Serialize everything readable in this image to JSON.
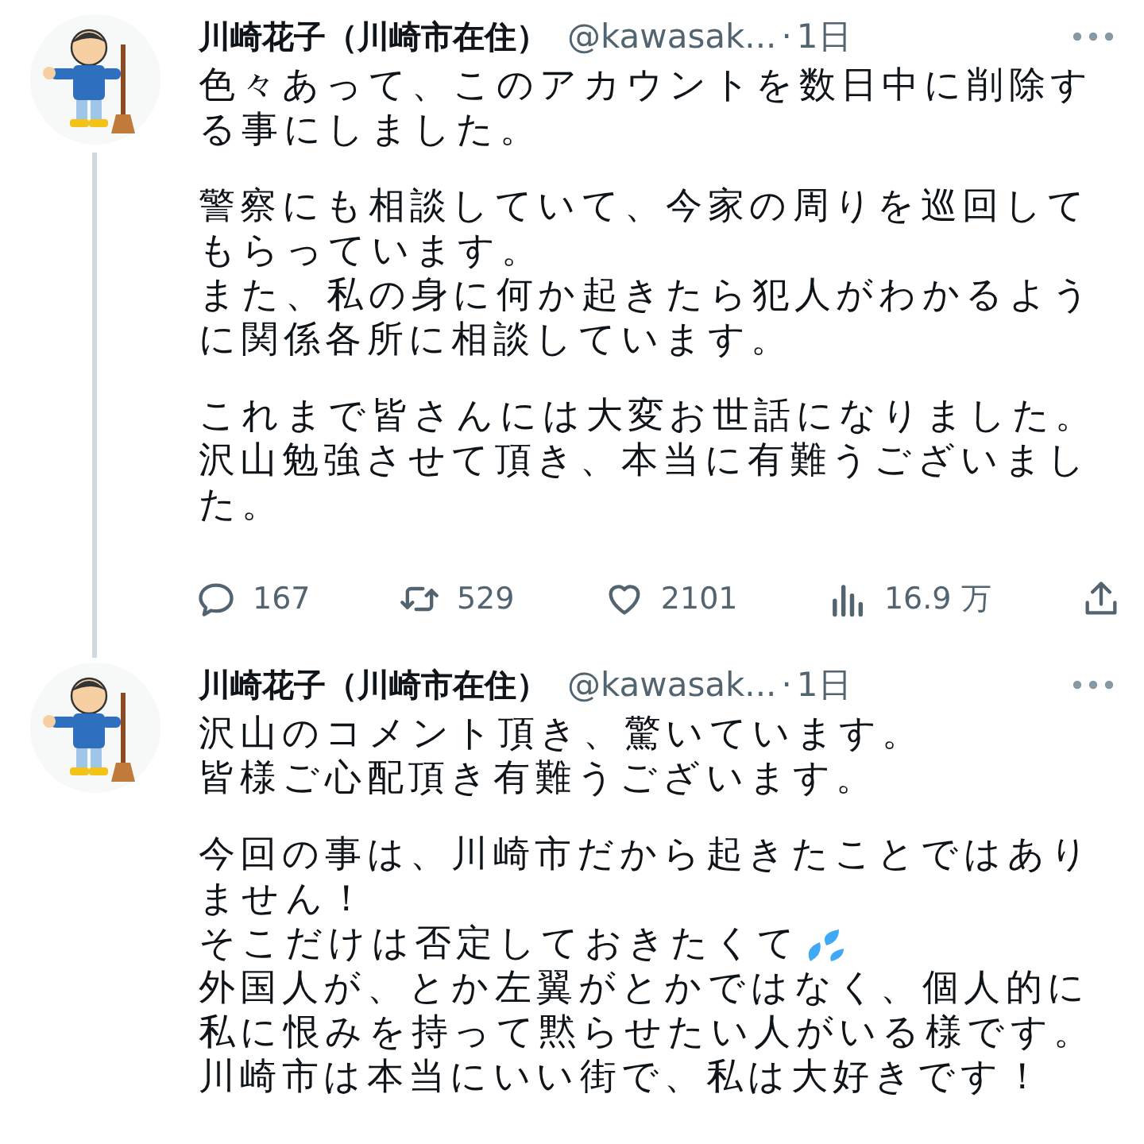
{
  "tweets": [
    {
      "name": "川崎花子（川崎市在住）",
      "handle": "@kawasak...",
      "separator": "·",
      "time": "1日",
      "thread_line": true,
      "paragraphs": [
        {
          "lines": [
            {
              "kind": "plain",
              "text": "色々あって、このアカウントを数日中に削除する事にしました。"
            }
          ]
        },
        {
          "lines": [
            {
              "kind": "plain",
              "text": "警察にも相談していて、今家の周りを巡回してもらっています。"
            },
            {
              "kind": "plain",
              "text": "また、私の身に何か起きたら犯人がわかるように関係各所に相談しています。"
            }
          ]
        },
        {
          "lines": [
            {
              "kind": "plain",
              "text": "これまで皆さんには大変お世話になりました。沢山勉強させて頂き、本当に有難うございました。"
            }
          ]
        }
      ],
      "actions": {
        "replies": "167",
        "retweets": "529",
        "likes": "2101",
        "views": "16.9 万"
      }
    },
    {
      "name": "川崎花子（川崎市在住）",
      "handle": "@kawasak...",
      "separator": "·",
      "time": "1日",
      "paragraphs": [
        {
          "lines": [
            {
              "kind": "plain",
              "text": "沢山のコメント頂き、驚いています。"
            },
            {
              "kind": "plain",
              "text": "皆様ご心配頂き有難うございます。"
            }
          ]
        },
        {
          "lines": [
            {
              "kind": "plain",
              "text": "今回の事は、川崎市だから起きたことではありません！"
            },
            {
              "kind": "with-icon",
              "text": "そこだけは否定しておきたくて"
            },
            {
              "kind": "plain",
              "text": "外国人が、とか左翼がとかではなく、個人的に私に恨みを持って黙らせたい人がいる様です。"
            },
            {
              "kind": "plain",
              "text": "川崎市は本当にいい街で、私は大好きです！"
            }
          ]
        }
      ]
    }
  ]
}
